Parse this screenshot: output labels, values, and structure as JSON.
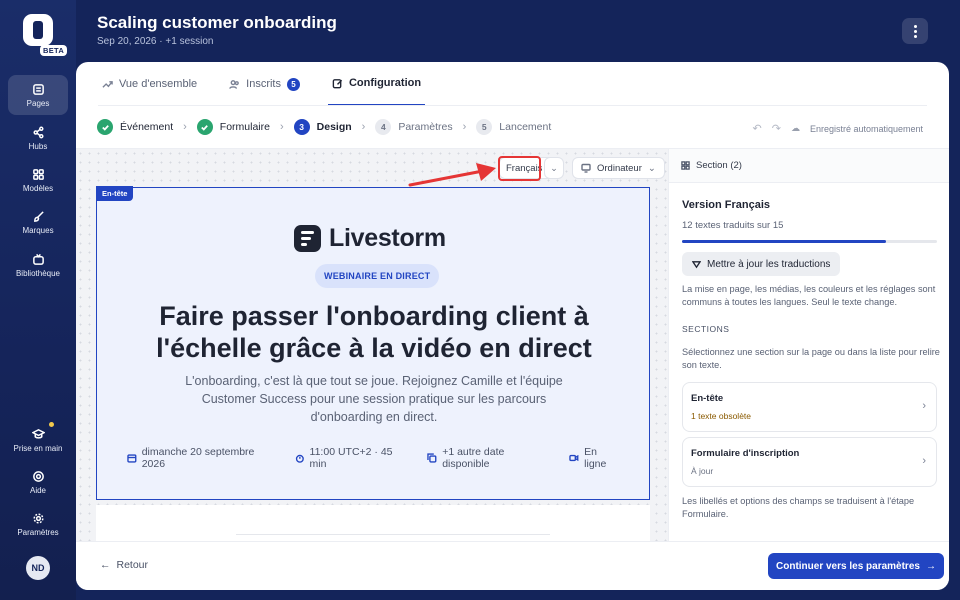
{
  "app": {
    "beta": "BETA",
    "user_initials": "ND"
  },
  "event": {
    "title": "Scaling customer onboarding",
    "subtitle": "Sep 20, 2026 · +1 session"
  },
  "rail": {
    "pages": "Pages",
    "hubs": "Hubs",
    "templates": "Modèles",
    "brands": "Marques",
    "library": "Bibliothèque",
    "getting_started": "Prise en main",
    "help": "Aide",
    "settings": "Paramètres"
  },
  "tabs": {
    "overview": "Vue d'ensemble",
    "registrants": "Inscrits",
    "registrants_count": "5",
    "configuration": "Configuration"
  },
  "steps": {
    "s1": "Événement",
    "s2": "Formulaire",
    "s3_num": "3",
    "s3": "Design",
    "s4_num": "4",
    "s4": "Paramètres",
    "s5_num": "5",
    "s5": "Lancement",
    "autosave": "Enregistré automatiquement"
  },
  "canvas": {
    "language": "Français",
    "device": "Ordinateur",
    "header_tag": "En-tête",
    "brand": "Livestorm",
    "pill": "WEBINAIRE EN DIRECT",
    "hero_title": "Faire passer l'onboarding client à l'échelle grâce à la vidéo en direct",
    "hero_sub": "L'onboarding, c'est là que tout se joue. Rejoignez Camille et l'équipe Customer Success pour une session pratique sur les parcours d'onboarding en direct.",
    "date": "dimanche 20 septembre 2026",
    "time": "11:00 UTC+2 · 45 min",
    "other_date": "+1 autre date disponible",
    "online": "En ligne"
  },
  "panel": {
    "head": "Section (2)",
    "version_title": "Version Français",
    "translated": "12 textes traduits sur 15",
    "progress": 0.8,
    "update_btn": "Mettre à jour les traductions",
    "note": "La mise en page, les médias, les couleurs et les réglages sont communs à toutes les langues. Seul le texte change.",
    "sections_label": "SECTIONS",
    "help": "Sélectionnez une section sur la page ou dans la liste pour relire son texte.",
    "sec1_title": "En-tête",
    "sec1_status": "1 texte obsolète",
    "sec2_title": "Formulaire d'inscription",
    "sec2_status": "À jour",
    "footnote": "Les libellés et options des champs se traduisent à l'étape Formulaire."
  },
  "footer": {
    "back": "Retour",
    "cta": "Continuer vers les paramètres"
  },
  "colors": {
    "accent": "#2245c2",
    "success": "#2aa56f",
    "warning": "#8a5a00",
    "highlight": "#e53535"
  }
}
